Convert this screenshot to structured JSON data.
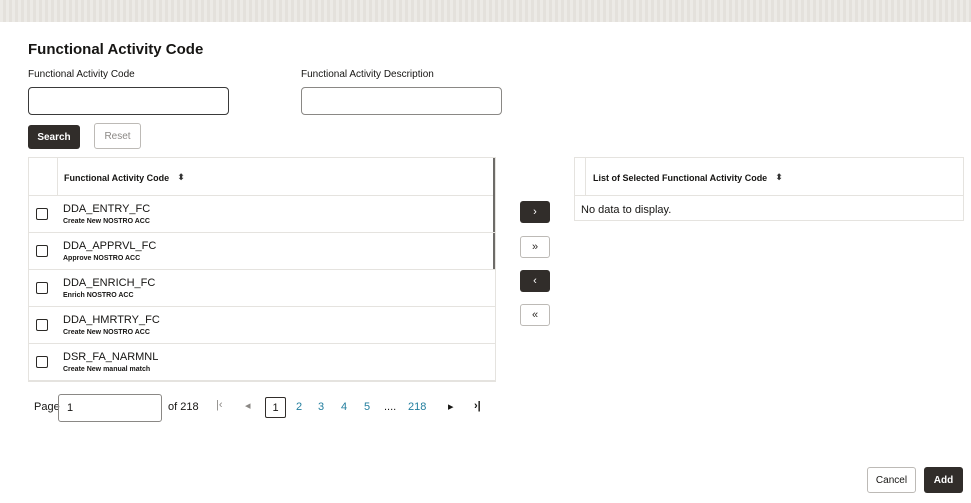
{
  "page": {
    "title": "Functional Activity Code"
  },
  "filters": {
    "code_label": "Functional Activity Code",
    "code_value": "",
    "desc_label": "Functional Activity Description",
    "desc_value": "",
    "search_label": "Search",
    "reset_label": "Reset"
  },
  "available_table": {
    "header": "Functional Activity Code",
    "sort_icon": "⬍",
    "rows": [
      {
        "code": "DDA_ENTRY_FC",
        "description": "Create New NOSTRO ACC",
        "checked": false
      },
      {
        "code": "DDA_APPRVL_FC",
        "description": "Approve NOSTRO ACC",
        "checked": false
      },
      {
        "code": "DDA_ENRICH_FC",
        "description": "Enrich NOSTRO ACC",
        "checked": false
      },
      {
        "code": "DDA_HMRTRY_FC",
        "description": "Create New NOSTRO ACC",
        "checked": false
      },
      {
        "code": "DSR_FA_NARMNL",
        "description": "Create New manual match",
        "checked": false
      }
    ]
  },
  "shuttle": {
    "move_one": "›",
    "move_all": "»",
    "remove_one": "‹",
    "remove_all": "«"
  },
  "selected_table": {
    "header": "List of Selected Functional Activity Code",
    "sort_icon": "⬍",
    "empty_text": "No data to display."
  },
  "pagination": {
    "label": "Page",
    "value": "1",
    "of_text": "of 218",
    "first_icon": "|‹",
    "prev_icon": "◂",
    "current": "1",
    "pages": [
      "2",
      "3",
      "4",
      "5",
      "....",
      "218"
    ],
    "next_icon": "▸",
    "last_icon": "›|"
  },
  "footer": {
    "cancel_label": "Cancel",
    "add_label": "Add"
  },
  "colors": {
    "dark_button": "#312d2a",
    "link": "#227e9e",
    "border": "#e5e3df"
  }
}
